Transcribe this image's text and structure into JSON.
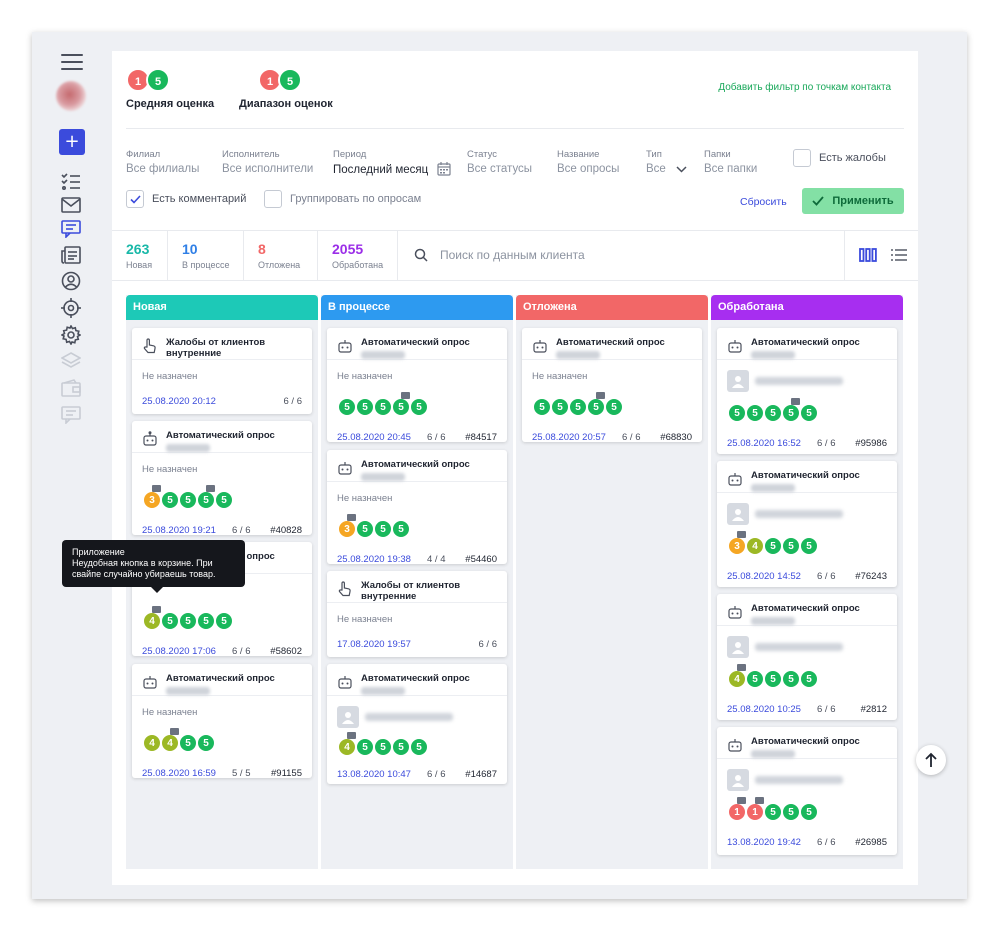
{
  "scores": {
    "average": {
      "label": "Средняя оценка",
      "low": "1",
      "high": "5"
    },
    "range": {
      "label": "Диапазон оценок",
      "low": "1",
      "high": "5"
    }
  },
  "add_filter": "Добавить фильтр по точкам контакта",
  "filters": {
    "branch": {
      "label": "Филиал",
      "value": "Все филиалы"
    },
    "executor": {
      "label": "Исполнитель",
      "value": "Все исполнители"
    },
    "period": {
      "label": "Период",
      "value": "Последний месяц"
    },
    "status": {
      "label": "Статус",
      "value": "Все статусы"
    },
    "name": {
      "label": "Название",
      "value": "Все опросы"
    },
    "type": {
      "label": "Тип",
      "value": "Все"
    },
    "folders": {
      "label": "Папки",
      "value": "Все папки"
    },
    "complaints": "Есть жалобы",
    "comment": "Есть комментарий",
    "group_by": "Группировать по опросам",
    "reset": "Сбросить",
    "apply": "Применить"
  },
  "stats": [
    {
      "num": "263",
      "label": "Новая",
      "color": "#19b8a8"
    },
    {
      "num": "10",
      "label": "В процессе",
      "color": "#2f7fe6"
    },
    {
      "num": "8",
      "label": "Отложена",
      "color": "#f26767"
    },
    {
      "num": "2055",
      "label": "Обработана",
      "color": "#9b2ee8"
    }
  ],
  "search": {
    "placeholder": "Поиск по данным клиента"
  },
  "columns": [
    {
      "title": "Новая",
      "color": "#1dc9b7"
    },
    {
      "title": "В процессе",
      "color": "#2d9af0"
    },
    {
      "title": "Отложена",
      "color": "#f26767"
    },
    {
      "title": "Обработана",
      "color": "#a72ef0"
    }
  ],
  "cards": {
    "new1": {
      "title1": "Жалобы от клиентов",
      "title2": "внутренние",
      "assignee": "Не назначен",
      "date": "25.08.2020 20:12",
      "count": "6 / 6",
      "id": ""
    },
    "new2": {
      "title1": "Автоматический опрос",
      "assignee": "Не назначен",
      "scores": [
        "3",
        "5",
        "5",
        "5",
        "5"
      ],
      "date": "25.08.2020 19:21",
      "count": "6 / 6",
      "id": "#40828"
    },
    "new3": {
      "title1": "Автоматический опрос",
      "scores": [
        "4",
        "5",
        "5",
        "5",
        "5"
      ],
      "date": "25.08.2020 17:06",
      "count": "6 / 6",
      "id": "#58602"
    },
    "new4": {
      "title1": "Автоматический опрос",
      "assignee": "Не назначен",
      "scores": [
        "4",
        "4",
        "5",
        "5"
      ],
      "date": "25.08.2020 16:59",
      "count": "5 / 5",
      "id": "#91155"
    },
    "proc1": {
      "title1": "Автоматический опрос",
      "assignee": "Не назначен",
      "scores": [
        "5",
        "5",
        "5",
        "5",
        "5"
      ],
      "date": "25.08.2020 20:45",
      "count": "6 / 6",
      "id": "#84517"
    },
    "proc2": {
      "title1": "Автоматический опрос",
      "assignee": "Не назначен",
      "scores": [
        "3",
        "5",
        "5",
        "5"
      ],
      "date": "25.08.2020 19:38",
      "count": "4 / 4",
      "id": "#54460"
    },
    "proc3": {
      "title1": "Жалобы от клиентов",
      "title2": "внутренние",
      "assignee": "Не назначен",
      "date": "17.08.2020 19:57",
      "count": "6 / 6",
      "id": ""
    },
    "proc4": {
      "title1": "Автоматический опрос",
      "scores": [
        "4",
        "5",
        "5",
        "5",
        "5"
      ],
      "date": "13.08.2020 10:47",
      "count": "6 / 6",
      "id": "#14687"
    },
    "post1": {
      "title1": "Автоматический опрос",
      "assignee": "Не назначен",
      "scores": [
        "5",
        "5",
        "5",
        "5",
        "5"
      ],
      "date": "25.08.2020 20:57",
      "count": "6 / 6",
      "id": "#68830"
    },
    "done1": {
      "title1": "Автоматический опрос",
      "scores": [
        "5",
        "5",
        "5",
        "5",
        "5"
      ],
      "date": "25.08.2020 16:52",
      "count": "6 / 6",
      "id": "#95986"
    },
    "done2": {
      "title1": "Автоматический опрос",
      "scores": [
        "3",
        "4",
        "5",
        "5",
        "5"
      ],
      "date": "25.08.2020 14:52",
      "count": "6 / 6",
      "id": "#76243"
    },
    "done3": {
      "title1": "Автоматический опрос",
      "scores": [
        "4",
        "5",
        "5",
        "5",
        "5"
      ],
      "date": "25.08.2020 10:25",
      "count": "6 / 6",
      "id": "#2812"
    },
    "done4": {
      "title1": "Автоматический опрос",
      "scores": [
        "1",
        "1",
        "5",
        "5",
        "5"
      ],
      "date": "13.08.2020 19:42",
      "count": "6 / 6",
      "id": "#26985"
    }
  },
  "tooltip": {
    "line1": "Приложение",
    "line2": "Неудобная кнопка в корзине. При",
    "line3": "свайпе случайно убираешь товар."
  },
  "colors": {
    "accent": "#3b4bdc",
    "green": "#19b85c",
    "red": "#f26767",
    "orange": "#f5a623",
    "olive": "#9cb825"
  }
}
